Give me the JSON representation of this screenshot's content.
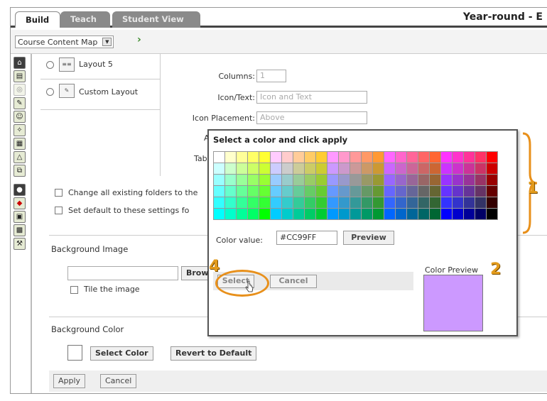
{
  "tabs": [
    {
      "label": "Build"
    },
    {
      "label": "Teach"
    },
    {
      "label": "Student View"
    }
  ],
  "course_title": "Year-round - E",
  "toolbar": {
    "map_select_value": "Course Content Map"
  },
  "layouts": {
    "layout5_label": "Layout 5",
    "custom_label": "Custom Layout"
  },
  "settings": {
    "columns_label": "Columns:",
    "columns_value": "1",
    "icon_text_label": "Icon/Text:",
    "icon_text_value": "Icon and Text",
    "icon_placement_label": "Icon Placement:",
    "icon_placement_value": "Above",
    "align_label": "Ali",
    "table_label": "Table"
  },
  "checkboxes": {
    "change_existing": "Change all existing folders to the",
    "set_default": "Set default to these settings fo"
  },
  "background_image": {
    "title": "Background Image",
    "browse_label": "Brows",
    "tile_label": "Tile the image"
  },
  "background_color": {
    "title": "Background Color",
    "select_color_label": "Select Color",
    "revert_label": "Revert to Default"
  },
  "footer": {
    "apply_label": "Apply",
    "cancel_label": "Cancel"
  },
  "popup": {
    "title": "Select a color and click apply",
    "color_value_label": "Color value:",
    "color_value": "#CC99FF",
    "preview_label": "Preview",
    "select_label": "Select",
    "cancel_label": "Cancel",
    "color_preview_label": "Color Preview",
    "preview_color": "#CC99FF",
    "palette_rows": [
      [
        "#FFFFFF",
        "#FFFFCC",
        "#FFFF99",
        "#FFFF66",
        "#FFFF33",
        "#FFCCFF",
        "#FFCCCC",
        "#FFCC99",
        "#FFCC66",
        "#FFCC33",
        "#FF99FF",
        "#FF99CC",
        "#FF9999",
        "#FF9966",
        "#FF9933",
        "#FF66FF",
        "#FF66CC",
        "#FF6699",
        "#FF6666",
        "#FF6633",
        "#FF33FF",
        "#FF33CC",
        "#FF3399",
        "#FF3366",
        "#FF0000"
      ],
      [
        "#CCFFFF",
        "#CCFFCC",
        "#CCFF99",
        "#CCFF66",
        "#CCFF33",
        "#CCCCFF",
        "#CCCCCC",
        "#CCCC99",
        "#CCCC66",
        "#CCCC33",
        "#CC99FF",
        "#CC99CC",
        "#CC9999",
        "#CC9966",
        "#CC9933",
        "#CC66FF",
        "#CC66CC",
        "#CC6699",
        "#CC6666",
        "#CC6633",
        "#CC33FF",
        "#CC33CC",
        "#CC3399",
        "#CC3366",
        "#CC0000"
      ],
      [
        "#99FFFF",
        "#99FFCC",
        "#99FF99",
        "#99FF66",
        "#99FF33",
        "#99CCFF",
        "#99CCCC",
        "#99CC99",
        "#99CC66",
        "#99CC33",
        "#9999FF",
        "#9999CC",
        "#999999",
        "#999966",
        "#999933",
        "#9966FF",
        "#9966CC",
        "#996699",
        "#996666",
        "#996633",
        "#9933FF",
        "#9933CC",
        "#993399",
        "#993366",
        "#990000"
      ],
      [
        "#66FFFF",
        "#66FFCC",
        "#66FF99",
        "#66FF66",
        "#66FF33",
        "#66CCFF",
        "#66CCCC",
        "#66CC99",
        "#66CC66",
        "#66CC33",
        "#6699FF",
        "#6699CC",
        "#669999",
        "#669966",
        "#669933",
        "#6666FF",
        "#6666CC",
        "#666699",
        "#666666",
        "#666633",
        "#6633FF",
        "#6633CC",
        "#663399",
        "#663366",
        "#660000"
      ],
      [
        "#33FFFF",
        "#33FFCC",
        "#33FF99",
        "#33FF66",
        "#33FF33",
        "#33CCFF",
        "#33CCCC",
        "#33CC99",
        "#33CC66",
        "#33CC33",
        "#3399FF",
        "#3399CC",
        "#339999",
        "#339966",
        "#339933",
        "#3366FF",
        "#3366CC",
        "#336699",
        "#336666",
        "#336633",
        "#3333FF",
        "#3333CC",
        "#333399",
        "#333366",
        "#330000"
      ],
      [
        "#00FFFF",
        "#00FFCC",
        "#00FF99",
        "#00FF66",
        "#00FF00",
        "#00CCFF",
        "#00CCCC",
        "#00CC99",
        "#00CC66",
        "#00CC33",
        "#0099FF",
        "#0099CC",
        "#009999",
        "#009966",
        "#009933",
        "#0066FF",
        "#0066CC",
        "#006699",
        "#006666",
        "#006633",
        "#0000FF",
        "#0000CC",
        "#000099",
        "#000066",
        "#000000"
      ]
    ]
  },
  "callouts": {
    "one": "1",
    "two": "2",
    "four": "4"
  },
  "colors": {
    "accent_orange": "#E8901B",
    "tab_inactive": "#8A8A8A"
  },
  "sidebar_icons": [
    "home-icon",
    "content-icon",
    "faded-icon",
    "tool-icon",
    "people-icon",
    "pin-icon",
    "document-icon",
    "assessment-icon",
    "share-icon",
    "settings-icon",
    "package-icon",
    "grid-icon",
    "image-icon",
    "wrench-icon"
  ]
}
